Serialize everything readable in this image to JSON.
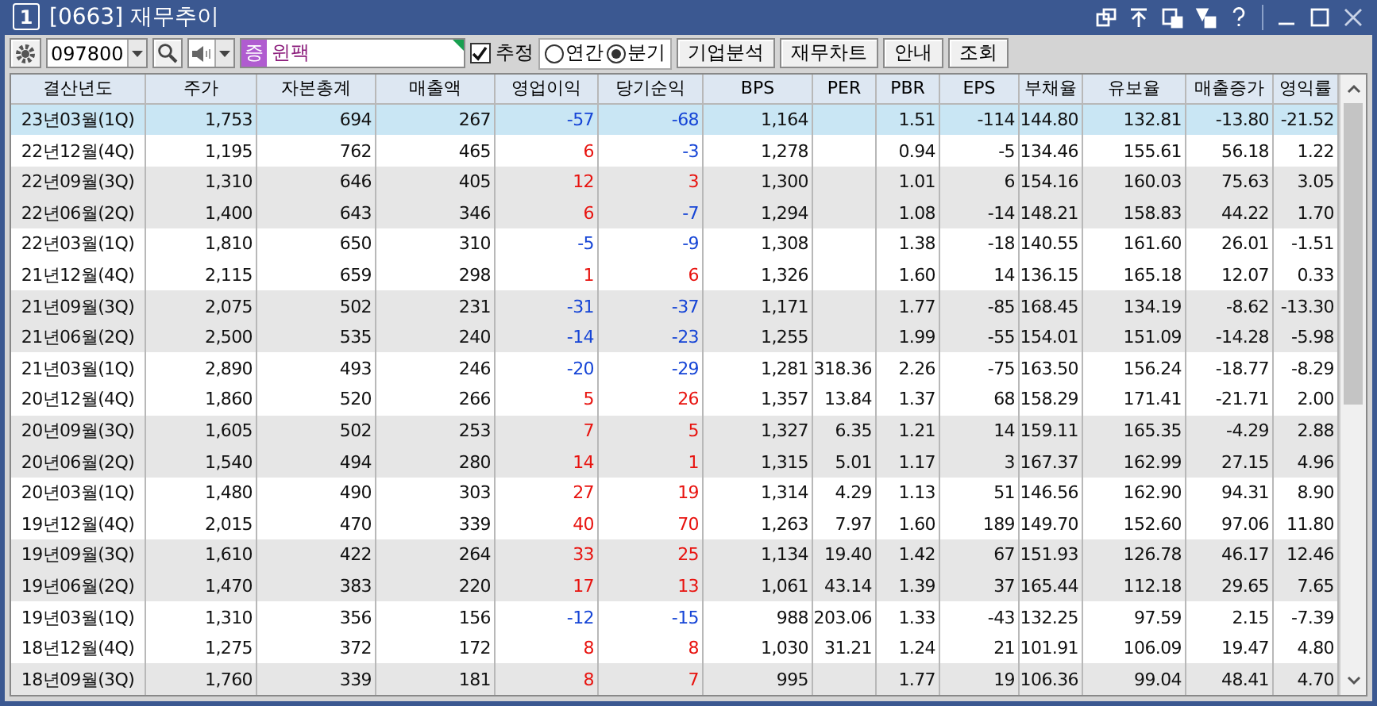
{
  "window": {
    "badge": "1",
    "title": "[0663] 재무추이"
  },
  "toolbar": {
    "code": "097800",
    "stock_badge": "증",
    "stock_name": "윈팩",
    "estimate": {
      "label": "추정",
      "checked": true
    },
    "period": [
      {
        "label": "연간",
        "selected": false
      },
      {
        "label": "분기",
        "selected": true
      }
    ],
    "buttons": [
      "기업분석",
      "재무차트",
      "안내",
      "조회"
    ]
  },
  "table": {
    "columns": [
      "결산년도",
      "주가",
      "자본총계",
      "매출액",
      "영업이익",
      "당기순익",
      "BPS",
      "PER",
      "PBR",
      "EPS",
      "부채율",
      "유보율",
      "매출증가",
      "영익률"
    ],
    "rows": [
      {
        "selected": true,
        "cells": [
          "23년03월(1Q)",
          "1,753",
          "694",
          "267",
          {
            "text": "-57",
            "color": "#1645d6"
          },
          {
            "text": "-68",
            "color": "#1645d6"
          },
          "1,164",
          "",
          "1.51",
          "-114",
          "144.80",
          "132.81",
          "-13.80",
          "-21.52"
        ]
      },
      {
        "selected": false,
        "cells": [
          "22년12월(4Q)",
          "1,195",
          "762",
          "465",
          {
            "text": "6",
            "color": "#e8130f"
          },
          {
            "text": "-3",
            "color": "#1645d6"
          },
          "1,278",
          "",
          "0.94",
          "-5",
          "134.46",
          "155.61",
          "56.18",
          "1.22"
        ]
      },
      {
        "selected": false,
        "cells": [
          "22년09월(3Q)",
          "1,310",
          "646",
          "405",
          {
            "text": "12",
            "color": "#e8130f"
          },
          {
            "text": "3",
            "color": "#e8130f"
          },
          "1,300",
          "",
          "1.01",
          "6",
          "154.16",
          "160.03",
          "75.63",
          "3.05"
        ]
      },
      {
        "selected": false,
        "cells": [
          "22년06월(2Q)",
          "1,400",
          "643",
          "346",
          {
            "text": "6",
            "color": "#e8130f"
          },
          {
            "text": "-7",
            "color": "#1645d6"
          },
          "1,294",
          "",
          "1.08",
          "-14",
          "148.21",
          "158.83",
          "44.22",
          "1.70"
        ]
      },
      {
        "selected": false,
        "cells": [
          "22년03월(1Q)",
          "1,810",
          "650",
          "310",
          {
            "text": "-5",
            "color": "#1645d6"
          },
          {
            "text": "-9",
            "color": "#1645d6"
          },
          "1,308",
          "",
          "1.38",
          "-18",
          "140.55",
          "161.60",
          "26.01",
          "-1.51"
        ]
      },
      {
        "selected": false,
        "cells": [
          "21년12월(4Q)",
          "2,115",
          "659",
          "298",
          {
            "text": "1",
            "color": "#e8130f"
          },
          {
            "text": "6",
            "color": "#e8130f"
          },
          "1,326",
          "",
          "1.60",
          "14",
          "136.15",
          "165.18",
          "12.07",
          "0.33"
        ]
      },
      {
        "selected": false,
        "cells": [
          "21년09월(3Q)",
          "2,075",
          "502",
          "231",
          {
            "text": "-31",
            "color": "#1645d6"
          },
          {
            "text": "-37",
            "color": "#1645d6"
          },
          "1,171",
          "",
          "1.77",
          "-85",
          "168.45",
          "134.19",
          "-8.62",
          "-13.30"
        ]
      },
      {
        "selected": false,
        "cells": [
          "21년06월(2Q)",
          "2,500",
          "535",
          "240",
          {
            "text": "-14",
            "color": "#1645d6"
          },
          {
            "text": "-23",
            "color": "#1645d6"
          },
          "1,255",
          "",
          "1.99",
          "-55",
          "154.01",
          "151.09",
          "-14.28",
          "-5.98"
        ]
      },
      {
        "selected": false,
        "cells": [
          "21년03월(1Q)",
          "2,890",
          "493",
          "246",
          {
            "text": "-20",
            "color": "#1645d6"
          },
          {
            "text": "-29",
            "color": "#1645d6"
          },
          "1,281",
          "318.36",
          "2.26",
          "-75",
          "163.50",
          "156.24",
          "-18.77",
          "-8.29"
        ]
      },
      {
        "selected": false,
        "cells": [
          "20년12월(4Q)",
          "1,860",
          "520",
          "266",
          {
            "text": "5",
            "color": "#e8130f"
          },
          {
            "text": "26",
            "color": "#e8130f"
          },
          "1,357",
          "13.84",
          "1.37",
          "68",
          "158.29",
          "171.41",
          "-21.71",
          "2.00"
        ]
      },
      {
        "selected": false,
        "cells": [
          "20년09월(3Q)",
          "1,605",
          "502",
          "253",
          {
            "text": "7",
            "color": "#e8130f"
          },
          {
            "text": "5",
            "color": "#e8130f"
          },
          "1,327",
          "6.35",
          "1.21",
          "14",
          "159.11",
          "165.35",
          "-4.29",
          "2.88"
        ]
      },
      {
        "selected": false,
        "cells": [
          "20년06월(2Q)",
          "1,540",
          "494",
          "280",
          {
            "text": "14",
            "color": "#e8130f"
          },
          {
            "text": "1",
            "color": "#e8130f"
          },
          "1,315",
          "5.01",
          "1.17",
          "3",
          "167.37",
          "162.99",
          "27.15",
          "4.96"
        ]
      },
      {
        "selected": false,
        "cells": [
          "20년03월(1Q)",
          "1,480",
          "490",
          "303",
          {
            "text": "27",
            "color": "#e8130f"
          },
          {
            "text": "19",
            "color": "#e8130f"
          },
          "1,314",
          "4.29",
          "1.13",
          "51",
          "146.56",
          "162.90",
          "94.31",
          "8.90"
        ]
      },
      {
        "selected": false,
        "cells": [
          "19년12월(4Q)",
          "2,015",
          "470",
          "339",
          {
            "text": "40",
            "color": "#e8130f"
          },
          {
            "text": "70",
            "color": "#e8130f"
          },
          "1,263",
          "7.97",
          "1.60",
          "189",
          "149.70",
          "152.60",
          "97.06",
          "11.80"
        ]
      },
      {
        "selected": false,
        "cells": [
          "19년09월(3Q)",
          "1,610",
          "422",
          "264",
          {
            "text": "33",
            "color": "#e8130f"
          },
          {
            "text": "25",
            "color": "#e8130f"
          },
          "1,134",
          "19.40",
          "1.42",
          "67",
          "151.93",
          "126.78",
          "46.17",
          "12.46"
        ]
      },
      {
        "selected": false,
        "cells": [
          "19년06월(2Q)",
          "1,470",
          "383",
          "220",
          {
            "text": "17",
            "color": "#e8130f"
          },
          {
            "text": "13",
            "color": "#e8130f"
          },
          "1,061",
          "43.14",
          "1.39",
          "37",
          "165.44",
          "112.18",
          "29.65",
          "7.65"
        ]
      },
      {
        "selected": false,
        "cells": [
          "19년03월(1Q)",
          "1,310",
          "356",
          "156",
          {
            "text": "-12",
            "color": "#1645d6"
          },
          {
            "text": "-15",
            "color": "#1645d6"
          },
          "988",
          "203.06",
          "1.33",
          "-43",
          "132.25",
          "97.59",
          "2.15",
          "-7.39"
        ]
      },
      {
        "selected": false,
        "cells": [
          "18년12월(4Q)",
          "1,275",
          "372",
          "172",
          {
            "text": "8",
            "color": "#e8130f"
          },
          {
            "text": "8",
            "color": "#e8130f"
          },
          "1,030",
          "31.21",
          "1.24",
          "21",
          "101.91",
          "106.09",
          "19.47",
          "4.80"
        ]
      },
      {
        "selected": false,
        "cells": [
          "18년09월(3Q)",
          "1,760",
          "339",
          "181",
          {
            "text": "8",
            "color": "#e8130f"
          },
          {
            "text": "7",
            "color": "#e8130f"
          },
          "995",
          "",
          "1.77",
          "19",
          "106.36",
          "99.04",
          "48.41",
          "4.70"
        ]
      }
    ]
  }
}
